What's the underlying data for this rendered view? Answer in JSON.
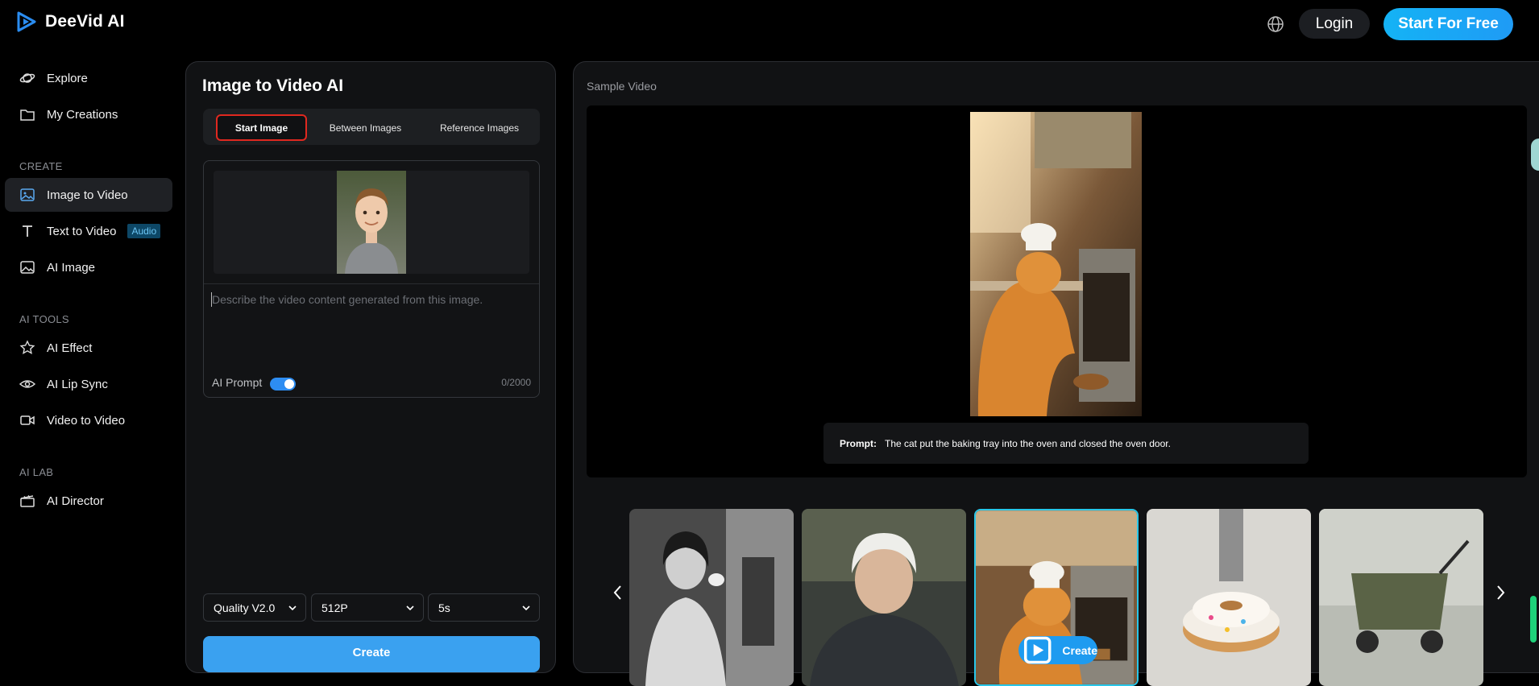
{
  "brand": {
    "name": "DeeVid AI",
    "accent": "#1f9bf5"
  },
  "header": {
    "login_label": "Login",
    "start_label": "Start For Free"
  },
  "sidebar": {
    "items": [
      {
        "label": "Explore",
        "icon": "planet-icon"
      },
      {
        "label": "My Creations",
        "icon": "folder-icon"
      }
    ],
    "create_section": "CREATE",
    "create_items": [
      {
        "label": "Image to Video",
        "icon": "image-icon"
      },
      {
        "label": "Text to Video",
        "icon": "text-icon",
        "badge": "Audio"
      },
      {
        "label": "AI Image",
        "icon": "gallery-icon"
      }
    ],
    "tools_section": "AI TOOLS",
    "tools_items": [
      {
        "label": "AI Effect",
        "icon": "star-icon"
      },
      {
        "label": "AI Lip Sync",
        "icon": "eye-icon"
      },
      {
        "label": "Video to Video",
        "icon": "camera-icon"
      }
    ],
    "lab_section": "AI LAB",
    "lab_items": [
      {
        "label": "AI Director",
        "icon": "clapper-icon"
      }
    ]
  },
  "editor": {
    "title": "Image to Video AI",
    "tabs": [
      "Start Image",
      "Between Images",
      "Reference Images"
    ],
    "prompt_placeholder": "Describe the video content generated from this image.",
    "ai_prompt_label": "AI Prompt",
    "ai_prompt_enabled": true,
    "counter": "0/2000",
    "quality": "Quality V2.0",
    "resolution": "512P",
    "duration": "5s",
    "create_label": "Create"
  },
  "sample": {
    "label": "Sample Video",
    "prompt_label": "Prompt:",
    "prompt_text": "The cat put the baking tray into the oven and closed the oven door.",
    "card_create_label": "Create"
  }
}
